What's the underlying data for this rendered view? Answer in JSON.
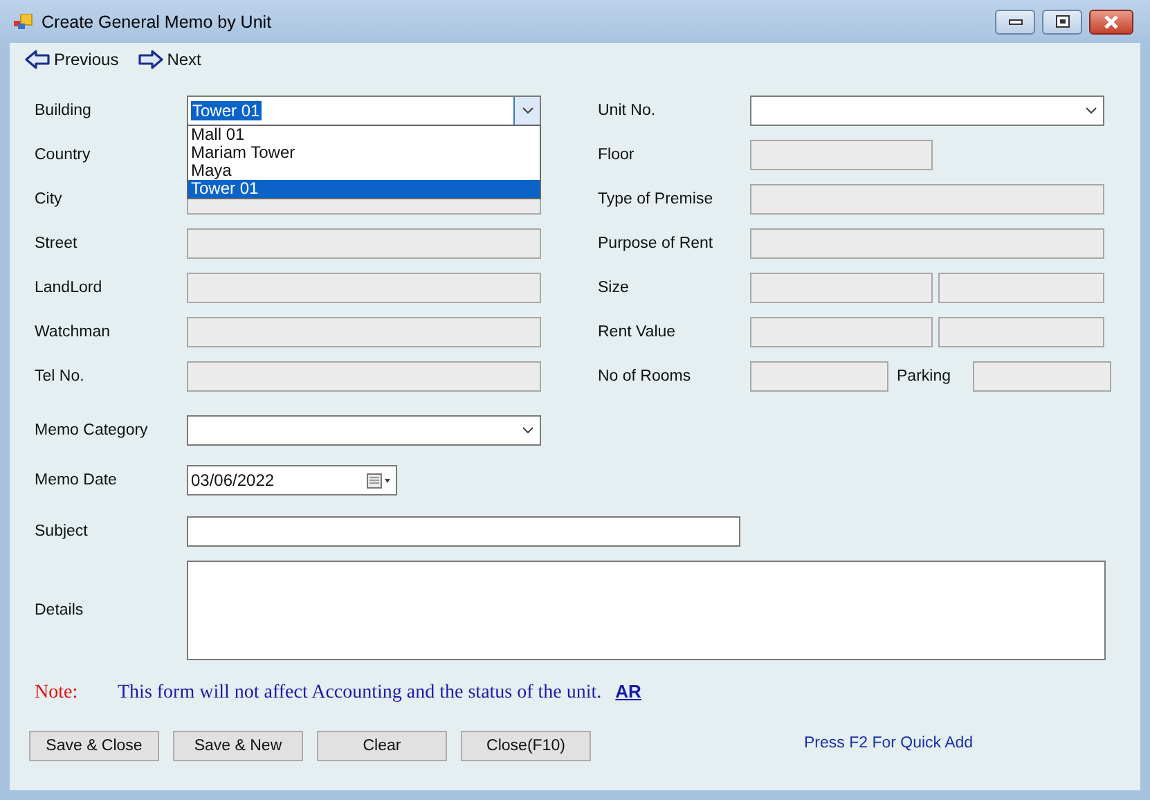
{
  "window": {
    "title": "Create General Memo by Unit"
  },
  "toolbar": [
    {
      "label": "Previous",
      "kind": "back"
    },
    {
      "label": "Next",
      "kind": "forward"
    }
  ],
  "rows": [
    {
      "left": {
        "label": "Building",
        "kind": "combo",
        "value": "Tower 01",
        "value_selected": true,
        "open": true
      },
      "right": {
        "label": "Unit No.",
        "kind": "combo"
      }
    },
    {
      "left": {
        "label": "Country",
        "kind": "none"
      },
      "right": {
        "label": "Floor",
        "kind": "short",
        "disabled": true
      }
    },
    {
      "left": {
        "label": "City",
        "kind": "text",
        "disabled": true
      },
      "right": {
        "label": "Type of Premise",
        "kind": "text",
        "disabled": true
      }
    },
    {
      "left": {
        "label": "Street",
        "kind": "text",
        "disabled": true
      },
      "right": {
        "label": "Purpose of Rent",
        "kind": "text",
        "disabled": true
      }
    },
    {
      "left": {
        "label": "LandLord",
        "kind": "text",
        "disabled": true
      },
      "right": {
        "label": "Size",
        "kind": "pair",
        "disabled": true
      }
    },
    {
      "left": {
        "label": "Watchman",
        "kind": "text",
        "disabled": true
      },
      "right": {
        "label": "Rent Value",
        "kind": "pair",
        "disabled": true
      }
    },
    {
      "left": {
        "label": "Tel No.",
        "kind": "text",
        "disabled": true
      },
      "right": {
        "label": "No of Rooms",
        "kind": "split",
        "second_label": "Parking",
        "disabled": true
      }
    }
  ],
  "building_dropdown": [
    {
      "label": "Mall 01",
      "selected": false
    },
    {
      "label": "Mariam Tower",
      "selected": false
    },
    {
      "label": "Maya",
      "selected": false
    },
    {
      "label": "Tower 01",
      "selected": true
    }
  ],
  "memo_category": {
    "label": "Memo Category"
  },
  "memo_date": {
    "label": "Memo Date",
    "value": "03/06/2022"
  },
  "subject": {
    "label": "Subject"
  },
  "details": {
    "label": "Details"
  },
  "note": {
    "label": "Note:",
    "text": "This form will not affect Accounting and the status of the unit.",
    "link": "AR"
  },
  "buttons": [
    "Save & Close",
    "Save & New",
    "Clear",
    "Close(F10)"
  ],
  "hint": "Press F2 For Quick Add"
}
